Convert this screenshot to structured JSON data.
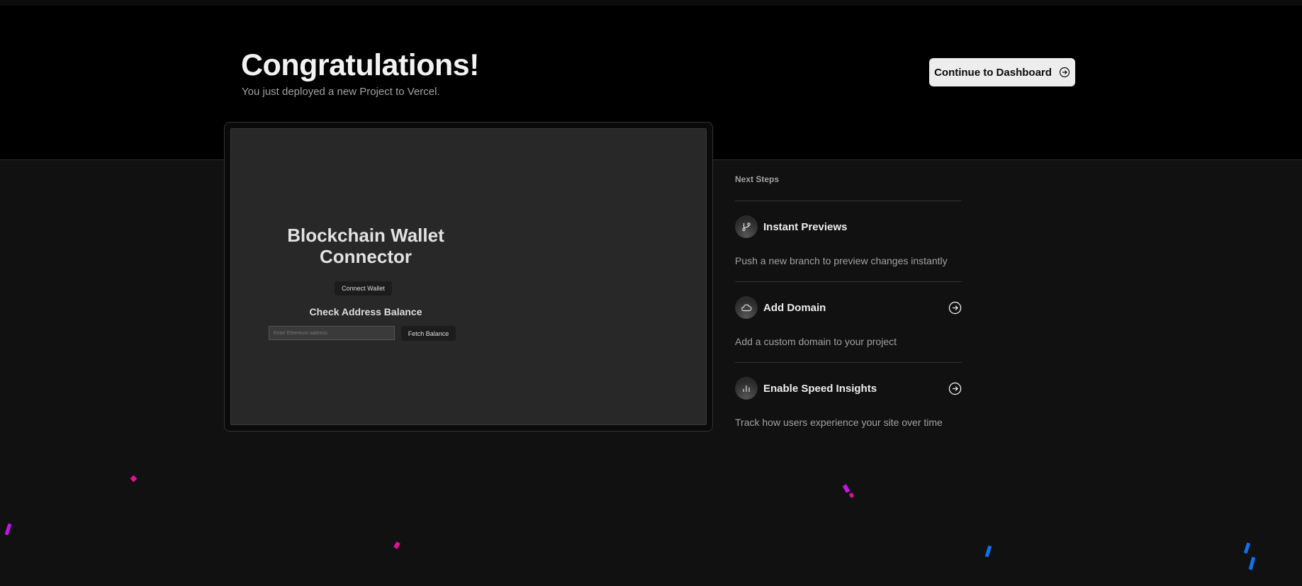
{
  "header": {
    "title": "Congratulations!",
    "subtitle": "You just deployed a new Project to Vercel.",
    "cta_label": "Continue to Dashboard"
  },
  "preview": {
    "app_title": "Blockchain Wallet Connector",
    "connect_label": "Connect Wallet",
    "check_heading": "Check Address Balance",
    "address_placeholder": "Enter Ethereum address",
    "fetch_label": "Fetch Balance"
  },
  "next_steps": {
    "heading": "Next Steps",
    "items": [
      {
        "title": "Instant Previews",
        "description": "Push a new branch to preview changes instantly",
        "icon": "git-branch-icon"
      },
      {
        "title": "Add Domain",
        "description": "Add a custom domain to your project",
        "icon": "cloud-icon"
      },
      {
        "title": "Enable Speed Insights",
        "description": "Track how users experience your site over time",
        "icon": "bar-chart-icon"
      }
    ]
  },
  "colors": {
    "confetti_pink": "#e0109a",
    "confetti_purple": "#c414e8",
    "confetti_blue": "#0a74f0"
  }
}
